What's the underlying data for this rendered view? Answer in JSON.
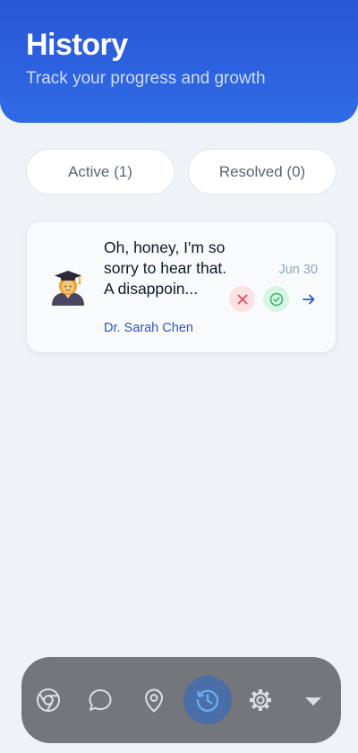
{
  "header": {
    "title": "History",
    "subtitle": "Track your progress and growth"
  },
  "tabs": [
    {
      "label": "Active (1)",
      "selected": true
    },
    {
      "label": "Resolved (0)",
      "selected": false
    }
  ],
  "items": [
    {
      "avatar_icon": "teacher-emoji-icon",
      "message": "Oh, honey, I'm so sorry to hear that.  A disappoin...",
      "author": "Dr. Sarah Chen",
      "date": "Jun 30"
    }
  ],
  "nav": {
    "items": [
      {
        "icon": "browser-icon"
      },
      {
        "icon": "chat-icon"
      },
      {
        "icon": "location-icon"
      },
      {
        "icon": "history-icon",
        "active": true
      },
      {
        "icon": "settings-icon"
      },
      {
        "icon": "dropdown-icon"
      }
    ]
  },
  "colors": {
    "header_gradient_top": "#2956d6",
    "header_gradient_bottom": "#2f6be6",
    "accent_blue": "#2f55c8",
    "reject_red": "#e04a5a",
    "resolve_green": "#2fb36b",
    "nav_background": "#73767a",
    "nav_active": "#4a6ea8",
    "nav_active_icon": "#6aaef5"
  }
}
